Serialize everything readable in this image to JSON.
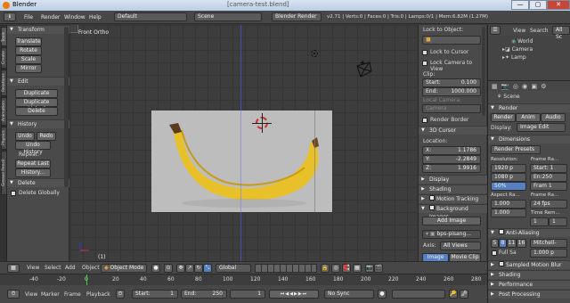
{
  "title": {
    "app": "Blender",
    "center": "[camera-test.blend]"
  },
  "window_buttons": [
    "—",
    "▢",
    "✕"
  ],
  "menu": {
    "items": [
      "File",
      "Render",
      "Window",
      "Help"
    ],
    "layout": "Default",
    "scene": "Scene",
    "engine": "Blender Render",
    "stats": "v2.71 | Verts:0 | Faces:0 | Tris:0 | Lamps:0/1 | Mem:6.82M (1.27M)"
  },
  "left_tabs": [
    "Tools",
    "Create",
    "Relations",
    "Animation",
    "Physics",
    "Grease Pencil"
  ],
  "toolshelf": {
    "transform": {
      "title": "Transform",
      "buttons": [
        "Translate",
        "Rotate",
        "Scale",
        "Mirror"
      ]
    },
    "edit": {
      "title": "Edit",
      "buttons": [
        "Duplicate",
        "Duplicate Linked",
        "Delete"
      ]
    },
    "history": {
      "title": "History",
      "undo": "Undo",
      "redo": "Redo",
      "undo_history": "Undo History",
      "repeat_label": "Repeat:",
      "repeat_last": "Repeat Last",
      "history": "History..."
    },
    "delete": {
      "title": "Delete",
      "delete_globally": "Delete Globally"
    }
  },
  "viewport": {
    "label": "Front Ortho",
    "frame_no": "(1)"
  },
  "n_panel": {
    "lock_to_object": "Lock to Object:",
    "lock_to_cursor": "Lock to Cursor",
    "lock_camera": "Lock Camera to View",
    "clip": "Clip:",
    "start_label": "Start:",
    "start_value": "0.100",
    "end_label": "End:",
    "end_value": "1000.000",
    "local_camera": "Local Camera:",
    "camera": "Camera",
    "render_border": "Render Border",
    "cursor_title": "3D Cursor",
    "location": "Location:",
    "x_label": "X:",
    "x_value": "1.1786",
    "y_label": "Y:",
    "y_value": "-2.2849",
    "z_label": "Z:",
    "z_value": "1.9916",
    "display": "Display",
    "shading": "Shading",
    "motion_tracking": "Motion Tracking",
    "background_images": "Background Images",
    "add_image": "Add Image",
    "image_name": "bps-pisang...",
    "axis_label": "Axis:",
    "axis_value": "All Views",
    "image_tab": "Image",
    "movie_tab": "Movie Clip"
  },
  "outliner": {
    "view": "View",
    "search": "Search",
    "all": "All Sc",
    "items": [
      "World",
      "Camera",
      "Lamp"
    ]
  },
  "properties": {
    "scene": "Scene",
    "render_section": "Render",
    "render_btn": "Render",
    "anim_btn": "Anim",
    "audio_btn": "Audio",
    "display_label": "Display:",
    "display_value": "Image Edit",
    "dimensions": "Dimensions",
    "presets": "Render Presets",
    "resolution": "Resolution:",
    "res_x": "1920 p",
    "res_y": "1080 p",
    "res_pct": "50%",
    "frame_range": "Frame Ra...",
    "fr_start": "Start: 1",
    "fr_end": "En:250",
    "fr_step": "Fram 1",
    "aspect": "Aspect Ra...",
    "aspect_x": "1.000",
    "aspect_y": "1.000",
    "frame_rate": "Frame Ra...",
    "fps": "24 fps",
    "time_rem": "Time Rem...",
    "time_a": "1",
    "time_b": "1",
    "anti_aliasing": "Anti-Aliasing",
    "aa_5": "5",
    "aa_8": "8",
    "aa_11": "11",
    "aa_16": "16",
    "filter": "Mitchell-",
    "full_sample": "Full Sa",
    "filter_size": "1.000 p",
    "sampled_motion_blur": "Sampled Motion Blur",
    "shading": "Shading",
    "performance": "Performance",
    "post_processing": "Post Processing"
  },
  "view3d_header": {
    "view": "View",
    "select": "Select",
    "add": "Add",
    "object": "Object",
    "mode": "Object Mode",
    "orientation": "Global"
  },
  "timeline": {
    "ticks": [
      "-40",
      "-20",
      "0",
      "20",
      "40",
      "60",
      "80",
      "100",
      "120",
      "140",
      "160",
      "180",
      "200",
      "220",
      "240",
      "260",
      "280"
    ],
    "view": "View",
    "marker": "Marker",
    "frame": "Frame",
    "playback": "Playback",
    "start_label": "Start:",
    "start": "1",
    "end_label": "End:",
    "end": "250",
    "current": "1",
    "sync": "No Sync"
  },
  "colors": {
    "accent": "#5680c2",
    "selected_obj": "#e8a13a",
    "background": "#393939"
  }
}
